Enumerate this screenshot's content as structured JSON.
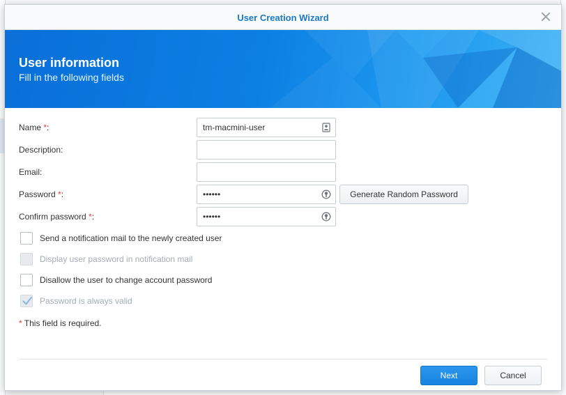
{
  "dialog": {
    "title": "User Creation Wizard",
    "banner_title": "User information",
    "banner_subtitle": "Fill in the following fields"
  },
  "fields": {
    "name": {
      "label": "Name ",
      "required_mark": "*",
      "colon": ":",
      "value": "tm-macmini-user"
    },
    "description": {
      "label": "Description:",
      "value": ""
    },
    "email": {
      "label": "Email:",
      "value": ""
    },
    "password": {
      "label": "Password ",
      "required_mark": "*",
      "colon": ":",
      "value": "••••••"
    },
    "confirm_password": {
      "label": "Confirm password ",
      "required_mark": "*",
      "colon": ":",
      "value": "••••••"
    }
  },
  "generate_button": "Generate Random Password",
  "checkboxes": [
    {
      "label": "Send a notification mail to the newly created user",
      "checked": false,
      "disabled": false
    },
    {
      "label": "Display user password in notification mail",
      "checked": false,
      "disabled": true
    },
    {
      "label": "Disallow the user to change account password",
      "checked": false,
      "disabled": false
    },
    {
      "label": "Password is always valid",
      "checked": true,
      "disabled": true
    }
  ],
  "required_note": {
    "mark": "*",
    "text": " This field is required."
  },
  "buttons": {
    "next": "Next",
    "cancel": "Cancel"
  },
  "icons": {
    "name_field": "contact-card-icon",
    "password_field": "password-strength-icon",
    "close": "close-icon"
  },
  "colors": {
    "accent": "#1a78c7",
    "primary_button": "#1584e0",
    "required": "#e23b3b"
  }
}
